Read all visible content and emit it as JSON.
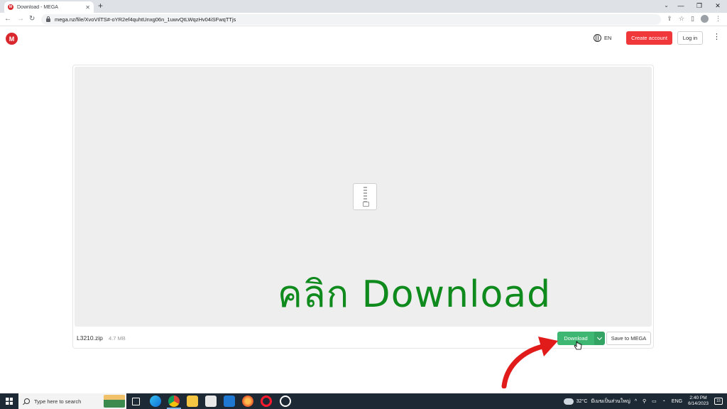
{
  "browser": {
    "tab_title": "Download - MEGA",
    "tab_favicon": "M",
    "new_tab": "+",
    "url": "mega.nz/file/XvoVIlTS#-oYR2ef4quhtUnxg06n_1uwvQtLWqzHv04iSFwqTTjs"
  },
  "header": {
    "logo": "M",
    "language": "EN",
    "create_account": "Create account",
    "login": "Log in"
  },
  "preview": {
    "overlay_text": "คลิก Download"
  },
  "file": {
    "name": "L3210.zip",
    "size": "4.7 MB",
    "download_label": "Download",
    "save_label": "Save to MEGA"
  },
  "taskbar": {
    "search_placeholder": "Type here to search",
    "weather": "32°C",
    "weather_desc": "มีเมฆเป็นส่วนใหญ่",
    "lang": "ENG",
    "time": "2:40 PM",
    "date": "6/14/2023",
    "notif_count": "15"
  },
  "colors": {
    "mega_red": "#d9272e",
    "create_account_bg": "#f0373a",
    "download_green": "#3eb772",
    "overlay_green": "#0f8a1c",
    "taskbar_bg": "#1d2a36"
  }
}
